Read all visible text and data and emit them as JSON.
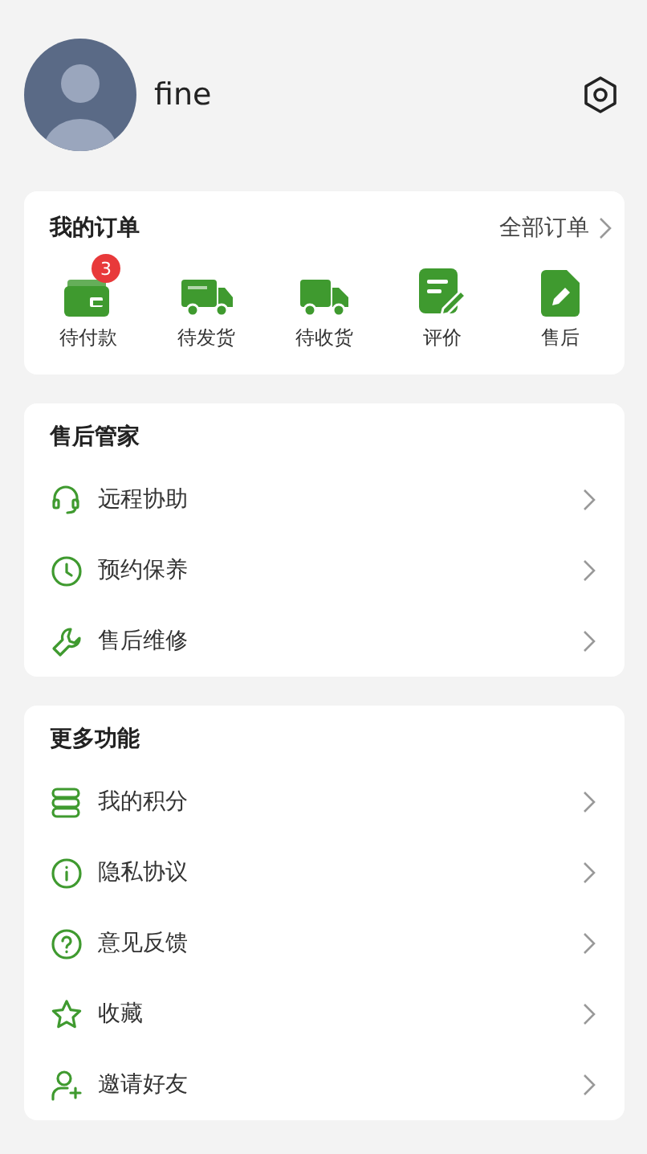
{
  "profile": {
    "name": "fine"
  },
  "orders": {
    "title": "我的订单",
    "all_link": "全部订单",
    "items": [
      {
        "label": "待付款",
        "badge": "3"
      },
      {
        "label": "待发货"
      },
      {
        "label": "待收货"
      },
      {
        "label": "评价"
      },
      {
        "label": "售后"
      }
    ]
  },
  "sections": [
    {
      "title": "售后管家",
      "items": [
        {
          "label": "远程协助"
        },
        {
          "label": "预约保养"
        },
        {
          "label": "售后维修"
        }
      ]
    },
    {
      "title": "更多功能",
      "items": [
        {
          "label": "我的积分"
        },
        {
          "label": "隐私协议"
        },
        {
          "label": "意见反馈"
        },
        {
          "label": "收藏"
        },
        {
          "label": "邀请好友"
        }
      ]
    }
  ]
}
